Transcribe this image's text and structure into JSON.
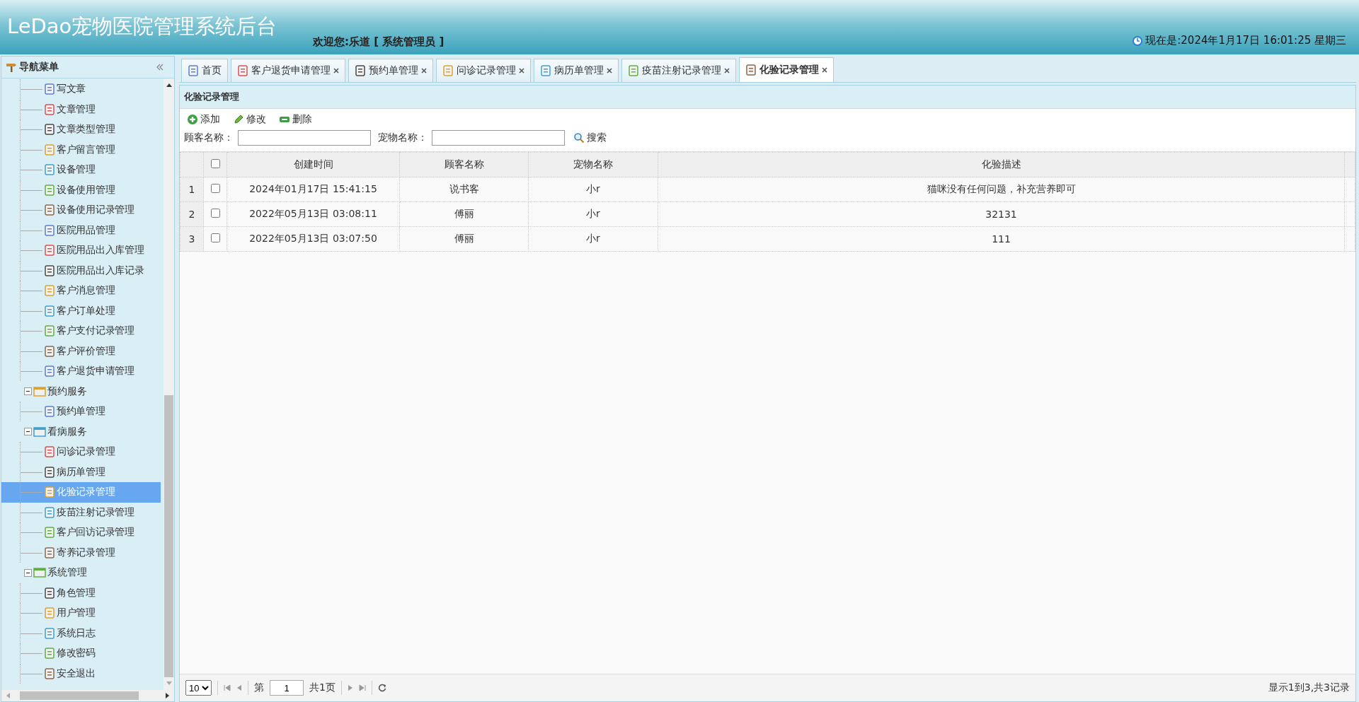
{
  "header": {
    "title": "LeDao宠物医院管理系统后台",
    "welcome": "欢迎您:乐道 [ 系统管理员 ]",
    "clock": "现在是:2024年1月17日 16:01:25 星期三"
  },
  "sidebar": {
    "title": "导航菜单",
    "scrolled_items": [
      {
        "label": "写文章",
        "selected": false
      },
      {
        "label": "文章管理",
        "selected": false
      },
      {
        "label": "文章类型管理",
        "selected": false
      },
      {
        "label": "客户留言管理",
        "selected": false
      },
      {
        "label": "设备管理",
        "selected": false
      },
      {
        "label": "设备使用管理",
        "selected": false
      },
      {
        "label": "设备使用记录管理",
        "selected": false
      },
      {
        "label": "医院用品管理",
        "selected": false
      },
      {
        "label": "医院用品出入库管理",
        "selected": false
      },
      {
        "label": "医院用品出入库记录",
        "selected": false
      },
      {
        "label": "客户消息管理",
        "selected": false
      },
      {
        "label": "客户订单处理",
        "selected": false
      },
      {
        "label": "客户支付记录管理",
        "selected": false
      },
      {
        "label": "客户评价管理",
        "selected": false
      },
      {
        "label": "客户退货申请管理",
        "selected": false
      }
    ],
    "groups": [
      {
        "label": "预约服务",
        "expanded": true,
        "children": [
          {
            "label": "预约单管理",
            "selected": false
          }
        ]
      },
      {
        "label": "看病服务",
        "expanded": true,
        "children": [
          {
            "label": "问诊记录管理",
            "selected": false
          },
          {
            "label": "病历单管理",
            "selected": false
          },
          {
            "label": "化验记录管理",
            "selected": true
          },
          {
            "label": "疫苗注射记录管理",
            "selected": false
          },
          {
            "label": "客户回访记录管理",
            "selected": false
          },
          {
            "label": "寄养记录管理",
            "selected": false
          }
        ]
      },
      {
        "label": "系统管理",
        "expanded": true,
        "children": [
          {
            "label": "角色管理",
            "selected": false
          },
          {
            "label": "用户管理",
            "selected": false
          },
          {
            "label": "系统日志",
            "selected": false
          },
          {
            "label": "修改密码",
            "selected": false
          },
          {
            "label": "安全退出",
            "selected": false
          }
        ]
      }
    ]
  },
  "tabs": [
    {
      "label": "首页",
      "selected": false,
      "closable": false
    },
    {
      "label": "客户退货申请管理",
      "selected": false,
      "closable": true
    },
    {
      "label": "预约单管理",
      "selected": false,
      "closable": true
    },
    {
      "label": "问诊记录管理",
      "selected": false,
      "closable": true
    },
    {
      "label": "病历单管理",
      "selected": false,
      "closable": true
    },
    {
      "label": "疫苗注射记录管理",
      "selected": false,
      "closable": true
    },
    {
      "label": "化验记录管理",
      "selected": true,
      "closable": true
    }
  ],
  "panel": {
    "title": "化验记录管理",
    "toolbar": [
      {
        "kind": "add",
        "label": "添加"
      },
      {
        "kind": "edit",
        "label": "修改"
      },
      {
        "kind": "remove",
        "label": "删除"
      }
    ],
    "search": {
      "fields": [
        {
          "label": "顾客名称："
        },
        {
          "label": "宠物名称："
        }
      ],
      "button": "搜索"
    },
    "table": {
      "all_checked": false,
      "columns": [
        "创建时间",
        "顾客名称",
        "宠物名称",
        "化验描述"
      ],
      "rows": [
        {
          "number": "1",
          "checked": false,
          "cells": [
            "2024年01月17日 15:41:15",
            "说书客",
            "小r",
            "猫咪没有任何问题，补充营养即可"
          ]
        },
        {
          "number": "2",
          "checked": false,
          "cells": [
            "2022年05月13日 03:08:11",
            "傅丽",
            "小r",
            "32131"
          ]
        },
        {
          "number": "3",
          "checked": false,
          "cells": [
            "2022年05月13日 03:07:50",
            "傅丽",
            "小r",
            "111"
          ]
        }
      ]
    },
    "pager": {
      "page_size": "10",
      "page_label": "第",
      "page": "1",
      "total_pages": "共1页",
      "summary": "显示1到3,共3记录"
    }
  }
}
